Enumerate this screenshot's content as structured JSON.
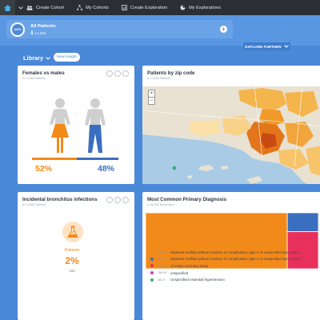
{
  "nav": {
    "items": [
      {
        "label": "Create Cohort",
        "icon": "people-icon"
      },
      {
        "label": "My Cohorts",
        "icon": "network-icon"
      },
      {
        "label": "Create Exploration",
        "icon": "chart-icon"
      },
      {
        "label": "My Explorations",
        "icon": "pie-icon"
      }
    ]
  },
  "patients": {
    "badge": "100%",
    "title": "All Patients",
    "count": "14,566",
    "add_label": "+"
  },
  "explore_further": "EXPLORE FURTHER",
  "library": {
    "label": "Library",
    "new_insight": "New insight"
  },
  "cards": {
    "gender": {
      "title": "Females vs males",
      "subtitle": "in 14,566 Patients",
      "female_pct": "52%",
      "male_pct": "48%",
      "female_share": 0.52,
      "male_share": 0.48
    },
    "zip": {
      "title": "Patients by zip code",
      "subtitle": "in 14,566 Patients",
      "zoom_in": "+",
      "zoom_out": "−"
    },
    "bronchitis": {
      "title": "Incidental bronchitus infections",
      "subtitle": "in 14,566 Patients",
      "label": "Patients",
      "pct": "2%",
      "count": "333"
    },
    "diagnosis": {
      "title": "Most Common Primary Diagnosis",
      "subtitle": "in 46,331 Encounters",
      "legend": [
        {
          "code": "250.00",
          "label": "Diabetes mellitus without mention of complication, type II or unspecified type, not st...",
          "color": "#f28a1a",
          "share": 0.68
        },
        {
          "code": "250.02",
          "label": "Diabetes mellitus without mention of complication, type II or unspecified type, uncon...",
          "color": "#3a6fbf",
          "share": 0.12
        },
        {
          "code": "414.01",
          "label": "of native coronary artery",
          "color": "#e8315a",
          "share": 0.1
        },
        {
          "code": "786.50",
          "label": "unspecified",
          "color": "#c93cc2",
          "share": 0.06
        },
        {
          "code": "401.9",
          "label": "Unspecified essential hypertension",
          "color": "#2db07c",
          "share": 0.04
        }
      ]
    }
  },
  "colors": {
    "female": "#f28a1a",
    "male": "#3a6fbf",
    "accent": "#4a88d8"
  }
}
